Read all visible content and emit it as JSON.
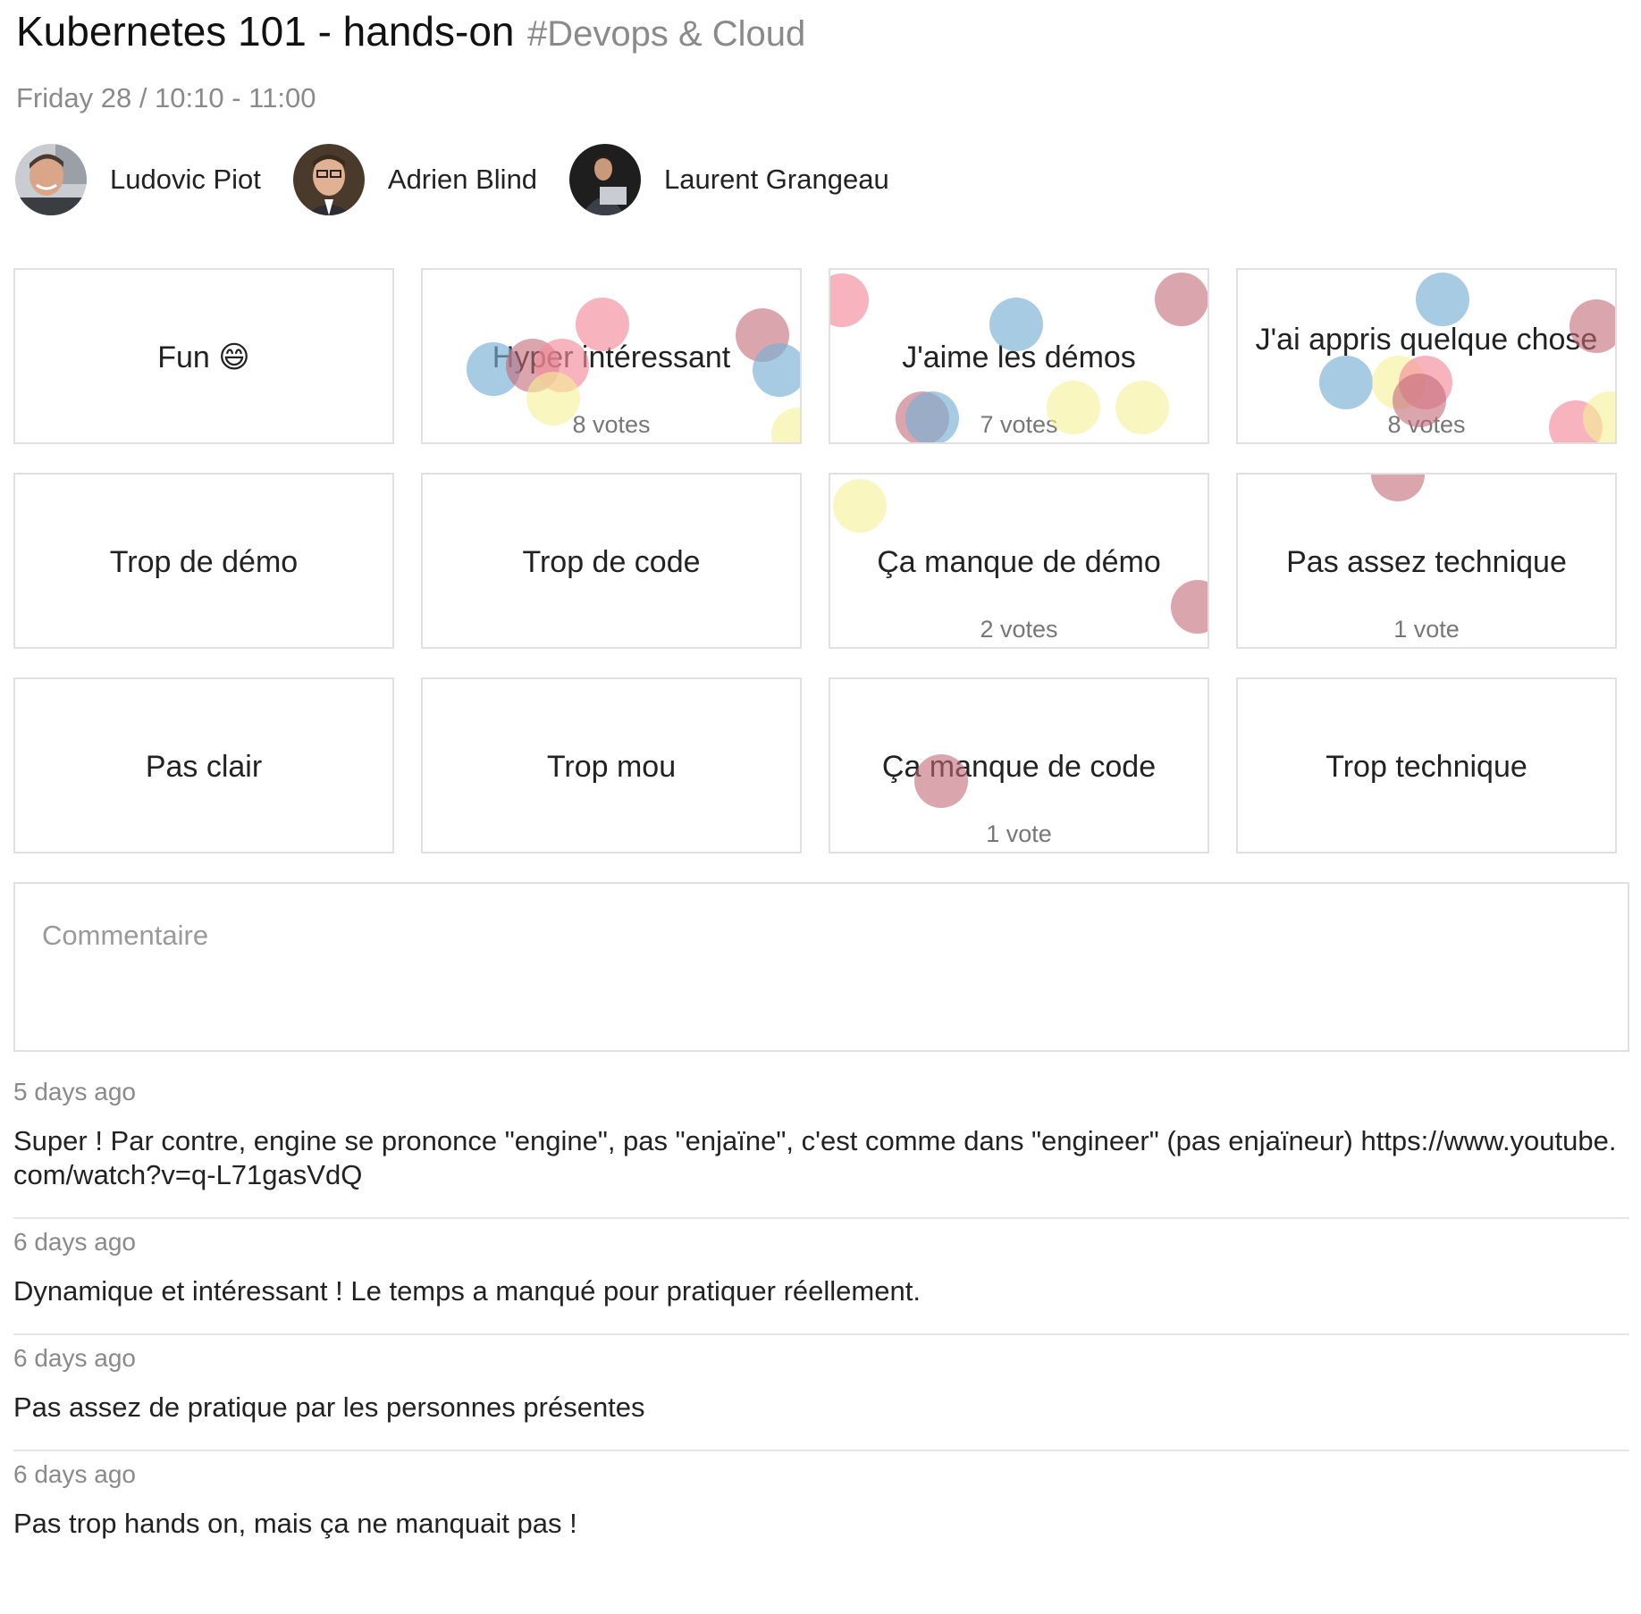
{
  "talk": {
    "title": "Kubernetes 101 - hands-on",
    "tag": "#Devops & Cloud",
    "schedule": "Friday 28 / 10:10 - 11:00"
  },
  "speakers": [
    {
      "name": "Ludovic Piot"
    },
    {
      "name": "Adrien Blind"
    },
    {
      "name": "Laurent Grangeau"
    }
  ],
  "feedback_cards": [
    {
      "label": "Fun 😄",
      "votes": ""
    },
    {
      "label": "Hyper intéressant",
      "votes": "8 votes"
    },
    {
      "label": "J'aime les démos",
      "votes": "7 votes"
    },
    {
      "label": "J'ai appris quelque chose",
      "votes": "8 votes"
    },
    {
      "label": "Trop de démo",
      "votes": ""
    },
    {
      "label": "Trop de code",
      "votes": ""
    },
    {
      "label": "Ça manque de démo",
      "votes": "2 votes"
    },
    {
      "label": "Pas assez technique",
      "votes": "1 vote"
    },
    {
      "label": "Pas clair",
      "votes": ""
    },
    {
      "label": "Trop mou",
      "votes": ""
    },
    {
      "label": "Ça manque de code",
      "votes": "1 vote"
    },
    {
      "label": "Trop technique",
      "votes": ""
    }
  ],
  "comment_input": {
    "placeholder": "Commentaire"
  },
  "comments": [
    {
      "time": "5 days ago",
      "text": "Super ! Par contre, engine se prononce \"engine\", pas \"enjaïne\", c'est comme dans \"engineer\" (pas enjaïneur) https://www.youtube.com/watch?v=q-L71gasVdQ"
    },
    {
      "time": "6 days ago",
      "text": "Dynamique et intéressant ! Le temps a manqué pour pratiquer réellement."
    },
    {
      "time": "6 days ago",
      "text": "Pas assez de pratique par les personnes présentes"
    },
    {
      "time": "6 days ago",
      "text": "Pas trop hands on, mais ça ne manquait pas !"
    }
  ],
  "colors": {
    "pink": "#f58c9b",
    "blue": "#78afd2",
    "yellow": "#f5f096",
    "rose": "#c36978"
  }
}
